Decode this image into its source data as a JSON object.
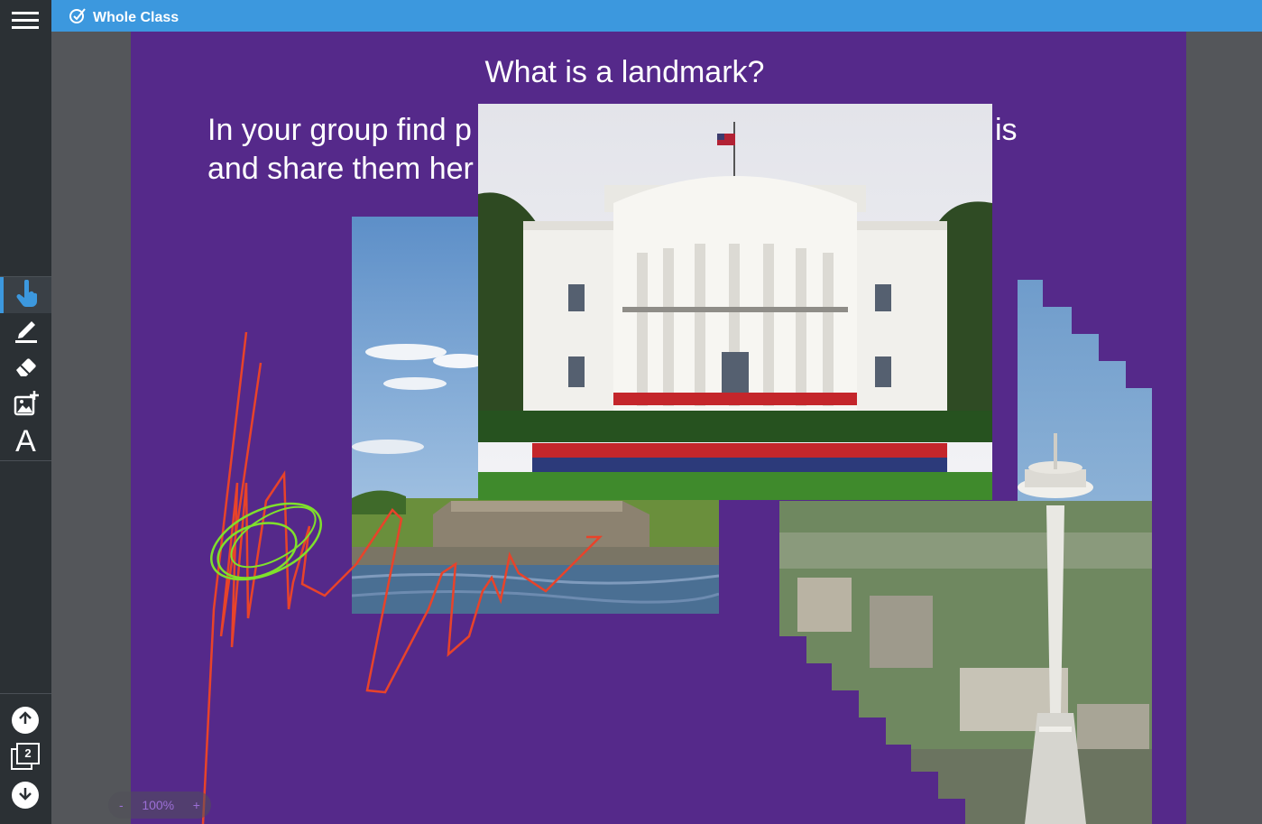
{
  "app": {
    "title": "Whole Class"
  },
  "toolbar": {
    "tools": [
      {
        "name": "pointer-tool",
        "active": true
      },
      {
        "name": "pen-tool",
        "active": false
      },
      {
        "name": "eraser-tool",
        "active": false
      },
      {
        "name": "add-image-tool",
        "active": false
      },
      {
        "name": "text-tool",
        "active": false
      }
    ],
    "page_count": "2"
  },
  "slide": {
    "title": "What is a landmark?",
    "instructions_line1": "In your group find p",
    "instructions_line2": "and share them her",
    "instructions_tail": "is"
  },
  "zoom": {
    "minus": "-",
    "level": "100%",
    "plus": "+"
  },
  "colors": {
    "accent": "#3c98de",
    "canvas": "#55298a",
    "sidebar": "#2b3034",
    "ink_red": "#e8432a",
    "ink_green": "#7fe02c"
  },
  "images": [
    "white-house-photo",
    "fort-wood-photo",
    "space-needle-photo"
  ]
}
